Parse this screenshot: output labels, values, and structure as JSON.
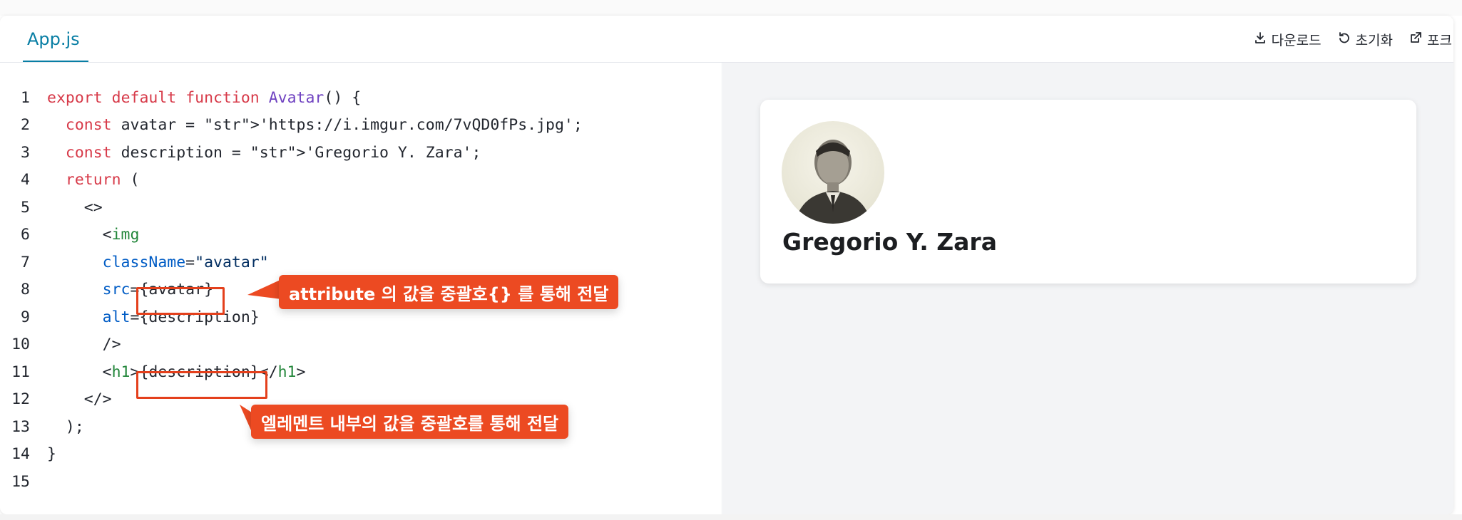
{
  "tab": {
    "label": "App.js"
  },
  "toolbar": {
    "download": "다운로드",
    "reset": "초기화",
    "fork": "포크"
  },
  "code_lines": [
    "export default function Avatar() {",
    "  const avatar = 'https://i.imgur.com/7vQD0fPs.jpg';",
    "  const description = 'Gregorio Y. Zara';",
    "  return (",
    "    <>",
    "      <img",
    "      className=\"avatar\"",
    "      src={avatar}",
    "      alt={description}",
    "      />",
    "      <h1>{description}</h1>",
    "    </>",
    "  );",
    "}",
    ""
  ],
  "annotations": {
    "attr": "attribute 의 값을 중괄호{} 를 통해 전달",
    "element": "엘레멘트 내부의 값을 중괄호를 통해 전달"
  },
  "preview": {
    "name": "Gregorio Y. Zara",
    "avatar_icon": "avatar-photo"
  },
  "colors": {
    "accent": "#087ea4",
    "callout": "#ec4a22",
    "keyword": "#d73a49",
    "string": "#032f62",
    "tag": "#22863a",
    "attr": "#005cc5",
    "function": "#6f42c1"
  }
}
